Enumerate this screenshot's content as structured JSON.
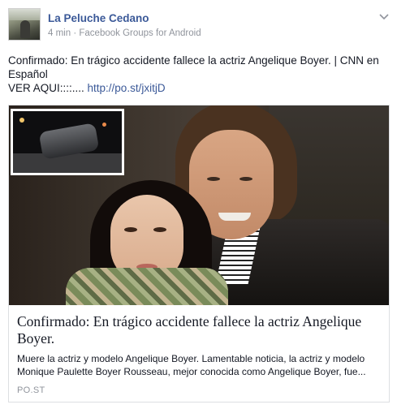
{
  "post": {
    "author": "La Peluche Cedano",
    "time": "4 min",
    "separator": "·",
    "source": "Facebook Groups for Android",
    "menu_icon": "chevron-down-icon",
    "text_line1": "Confirmado: En trágico accidente fallece la actriz Angelique Boyer. | CNN en Español",
    "text_prefix": "VER AQUI::::.... ",
    "link": "http://po.st/jxitjD"
  },
  "link_card": {
    "title": "Confirmado: En trágico accidente fallece la actriz Angelique Boyer.",
    "description": "Muere la actriz y modelo Angelique Boyer. Lamentable noticia, la actriz y modelo Monique Paulette Boyer Rousseau, mejor conocida como Angelique Boyer, fue...",
    "domain": "PO.ST"
  },
  "colors": {
    "name": "#3b5998",
    "meta": "#90949c",
    "text": "#141823",
    "link": "#3b5998",
    "border": "#dddfe2"
  }
}
